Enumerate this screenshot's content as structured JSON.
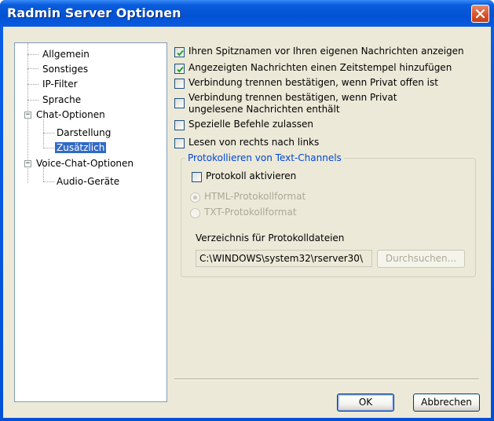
{
  "window": {
    "title": "Radmin Server Optionen"
  },
  "tree": {
    "items": [
      {
        "label": "Allgemein"
      },
      {
        "label": "Sonstiges"
      },
      {
        "label": "IP-Filter"
      },
      {
        "label": "Sprache"
      },
      {
        "label": "Chat-Optionen",
        "expander": "−"
      },
      {
        "label": "Darstellung"
      },
      {
        "label": "Zusätzlich",
        "selected": true
      },
      {
        "label": "Voice-Chat-Optionen",
        "expander": "−"
      },
      {
        "label": "Audio-Geräte"
      }
    ]
  },
  "options": {
    "show_nick": {
      "label": "Ihren Spitznamen vor Ihren eigenen Nachrichten anzeigen",
      "checked": true
    },
    "timestamp": {
      "label": "Angezeigten Nachrichten einen Zeitstempel hinzufügen",
      "checked": true
    },
    "confirm_disconnect_private_open": {
      "label": "Verbindung trennen bestätigen, wenn Privat offen ist",
      "checked": false
    },
    "confirm_disconnect_unread_line1": "Verbindung trennen bestätigen, wenn Privat",
    "confirm_disconnect_unread_line2": "ungelesene Nachrichten enthält",
    "special_commands": {
      "label": "Spezielle Befehle zulassen",
      "checked": false
    },
    "rtl": {
      "label": "Lesen von rechts nach links",
      "checked": false
    }
  },
  "logging": {
    "legend": "Protokollieren von Text-Channels",
    "enable_label": "Protokoll aktivieren",
    "format_html": "HTML-Protokollformat",
    "format_txt": "TXT-Protokollformat",
    "dir_label": "Verzeichnis für Protokolldateien",
    "dir_value": "C:\\WINDOWS\\system32\\rserver30\\",
    "browse_label": "Durchsuchen..."
  },
  "buttons": {
    "ok": "OK",
    "cancel": "Abbrechen"
  },
  "colors": {
    "titlebar": "#0a5ddc",
    "selection": "#316ac5",
    "groupbox_title": "#0046d5",
    "dialog_bg": "#ece9d8"
  }
}
